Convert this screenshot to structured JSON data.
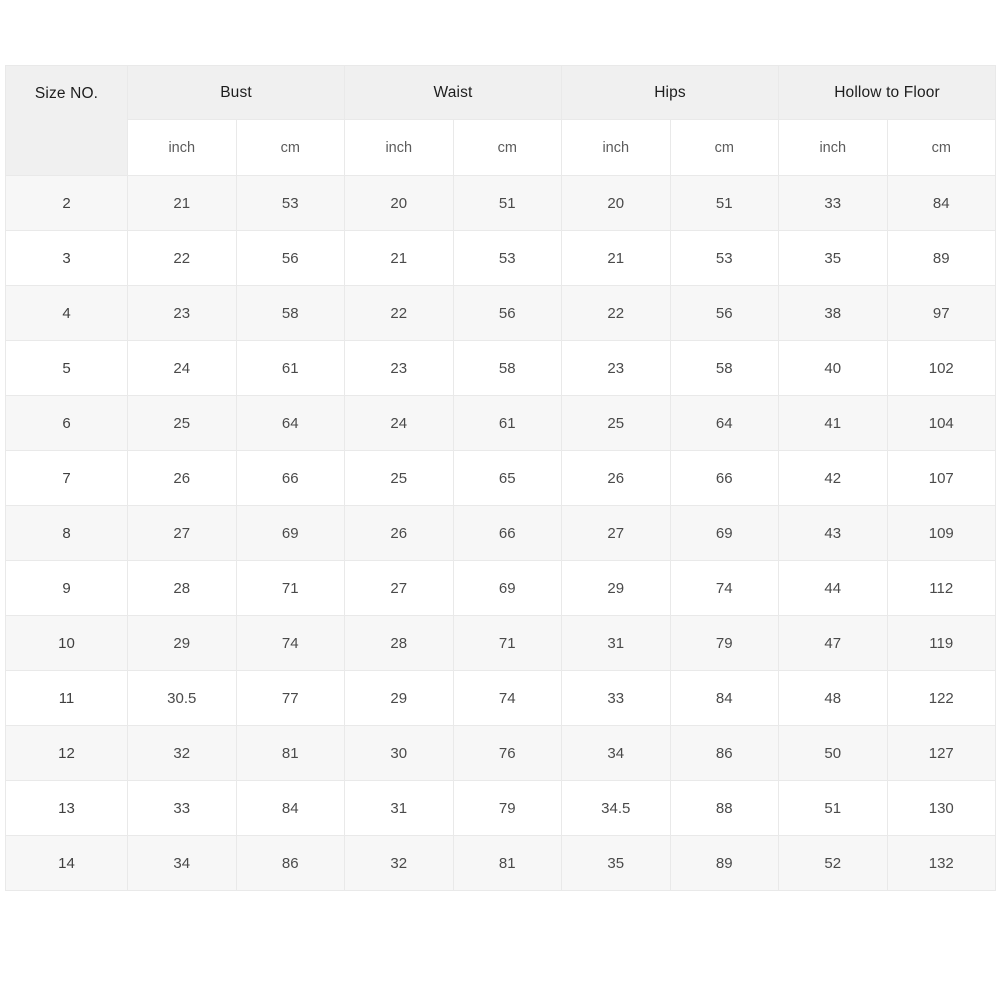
{
  "table": {
    "groups": [
      {
        "label": "Size NO.",
        "spans": 1,
        "units": []
      },
      {
        "label": "Bust",
        "spans": 2,
        "units": [
          "inch",
          "cm"
        ]
      },
      {
        "label": "Waist",
        "spans": 2,
        "units": [
          "inch",
          "cm"
        ]
      },
      {
        "label": "Hips",
        "spans": 2,
        "units": [
          "inch",
          "cm"
        ]
      },
      {
        "label": "Hollow to Floor",
        "spans": 2,
        "units": [
          "inch",
          "cm"
        ]
      }
    ],
    "unit_row": [
      "",
      "inch",
      "cm",
      "inch",
      "cm",
      "inch",
      "cm",
      "inch",
      "cm"
    ],
    "column_headers": [
      "Size NO.",
      "Bust inch",
      "Bust cm",
      "Waist inch",
      "Waist cm",
      "Hips inch",
      "Hips cm",
      "Hollow to Floor inch",
      "Hollow to Floor cm"
    ],
    "rows": [
      {
        "size": "2",
        "bust_inch": "21",
        "bust_cm": "53",
        "waist_inch": "20",
        "waist_cm": "51",
        "hips_inch": "20",
        "hips_cm": "51",
        "hollow_inch": "33",
        "hollow_cm": "84"
      },
      {
        "size": "3",
        "bust_inch": "22",
        "bust_cm": "56",
        "waist_inch": "21",
        "waist_cm": "53",
        "hips_inch": "21",
        "hips_cm": "53",
        "hollow_inch": "35",
        "hollow_cm": "89"
      },
      {
        "size": "4",
        "bust_inch": "23",
        "bust_cm": "58",
        "waist_inch": "22",
        "waist_cm": "56",
        "hips_inch": "22",
        "hips_cm": "56",
        "hollow_inch": "38",
        "hollow_cm": "97"
      },
      {
        "size": "5",
        "bust_inch": "24",
        "bust_cm": "61",
        "waist_inch": "23",
        "waist_cm": "58",
        "hips_inch": "23",
        "hips_cm": "58",
        "hollow_inch": "40",
        "hollow_cm": "102"
      },
      {
        "size": "6",
        "bust_inch": "25",
        "bust_cm": "64",
        "waist_inch": "24",
        "waist_cm": "61",
        "hips_inch": "25",
        "hips_cm": "64",
        "hollow_inch": "41",
        "hollow_cm": "104"
      },
      {
        "size": "7",
        "bust_inch": "26",
        "bust_cm": "66",
        "waist_inch": "25",
        "waist_cm": "65",
        "hips_inch": "26",
        "hips_cm": "66",
        "hollow_inch": "42",
        "hollow_cm": "107"
      },
      {
        "size": "8",
        "bust_inch": "27",
        "bust_cm": "69",
        "waist_inch": "26",
        "waist_cm": "66",
        "hips_inch": "27",
        "hips_cm": "69",
        "hollow_inch": "43",
        "hollow_cm": "109"
      },
      {
        "size": "9",
        "bust_inch": "28",
        "bust_cm": "71",
        "waist_inch": "27",
        "waist_cm": "69",
        "hips_inch": "29",
        "hips_cm": "74",
        "hollow_inch": "44",
        "hollow_cm": "112"
      },
      {
        "size": "10",
        "bust_inch": "29",
        "bust_cm": "74",
        "waist_inch": "28",
        "waist_cm": "71",
        "hips_inch": "31",
        "hips_cm": "79",
        "hollow_inch": "47",
        "hollow_cm": "119"
      },
      {
        "size": "11",
        "bust_inch": "30.5",
        "bust_cm": "77",
        "waist_inch": "29",
        "waist_cm": "74",
        "hips_inch": "33",
        "hips_cm": "84",
        "hollow_inch": "48",
        "hollow_cm": "122"
      },
      {
        "size": "12",
        "bust_inch": "32",
        "bust_cm": "81",
        "waist_inch": "30",
        "waist_cm": "76",
        "hips_inch": "34",
        "hips_cm": "86",
        "hollow_inch": "50",
        "hollow_cm": "127"
      },
      {
        "size": "13",
        "bust_inch": "33",
        "bust_cm": "84",
        "waist_inch": "31",
        "waist_cm": "79",
        "hips_inch": "34.5",
        "hips_cm": "88",
        "hollow_inch": "51",
        "hollow_cm": "130"
      },
      {
        "size": "14",
        "bust_inch": "34",
        "bust_cm": "86",
        "waist_inch": "32",
        "waist_cm": "81",
        "hips_inch": "35",
        "hips_cm": "89",
        "hollow_inch": "52",
        "hollow_cm": "132"
      }
    ]
  },
  "colors": {
    "page_background": "#ffffff",
    "group_header_background": "#f0f0f0",
    "unit_header_background": "#ffffff",
    "row_stripe_background": "#f7f7f7",
    "row_plain_background": "#ffffff",
    "border": "#e9e9e9",
    "header_text": "#1d1d1d",
    "unit_text": "#5c5c5c",
    "cell_text": "#4a4a4a"
  }
}
